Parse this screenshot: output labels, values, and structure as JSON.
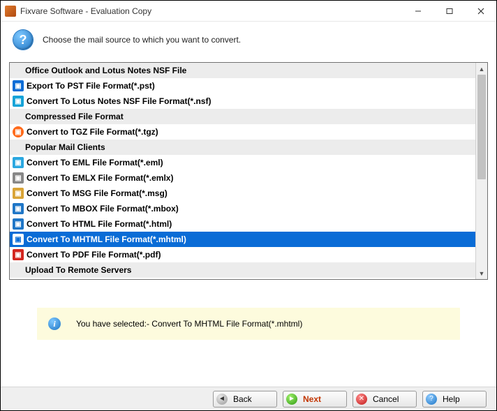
{
  "window": {
    "title": "Fixvare Software - Evaluation Copy"
  },
  "instruction": "Choose the mail source to which you want to convert.",
  "list": [
    {
      "kind": "header",
      "label": "Office Outlook and Lotus Notes NSF File"
    },
    {
      "kind": "item",
      "icon": "outlook",
      "iconColor": "#0a6cd6",
      "label": "Export To PST File Format(*.pst)"
    },
    {
      "kind": "item",
      "icon": "notes",
      "iconColor": "#16a3d8",
      "label": "Convert To Lotus Notes NSF File Format(*.nsf)"
    },
    {
      "kind": "header",
      "label": "Compressed File Format"
    },
    {
      "kind": "item",
      "icon": "tgz",
      "iconColor": "#ff6a1a",
      "label": "Convert to TGZ File Format(*.tgz)"
    },
    {
      "kind": "header",
      "label": "Popular Mail Clients"
    },
    {
      "kind": "item",
      "icon": "eml",
      "iconColor": "#2aa7e0",
      "label": "Convert To EML File Format(*.eml)"
    },
    {
      "kind": "item",
      "icon": "emlx",
      "iconColor": "#888888",
      "label": "Convert To EMLX File Format(*.emlx)"
    },
    {
      "kind": "item",
      "icon": "msg",
      "iconColor": "#d9a437",
      "label": "Convert To MSG File Format(*.msg)"
    },
    {
      "kind": "item",
      "icon": "mbox",
      "iconColor": "#1f76c7",
      "label": "Convert To MBOX File Format(*.mbox)"
    },
    {
      "kind": "item",
      "icon": "html",
      "iconColor": "#1f76c7",
      "label": "Convert To HTML File Format(*.html)"
    },
    {
      "kind": "item",
      "icon": "mhtml",
      "iconColor": "#ffffff",
      "label": "Convert To MHTML File Format(*.mhtml)",
      "selected": true
    },
    {
      "kind": "item",
      "icon": "pdf",
      "iconColor": "#d3261f",
      "label": "Convert To PDF File Format(*.pdf)"
    },
    {
      "kind": "header",
      "label": "Upload To Remote Servers"
    }
  ],
  "banner": {
    "text": "You have selected:- Convert To MHTML File Format(*.mhtml)"
  },
  "buttons": {
    "back": "Back",
    "next": "Next",
    "cancel": "Cancel",
    "help": "Help"
  }
}
